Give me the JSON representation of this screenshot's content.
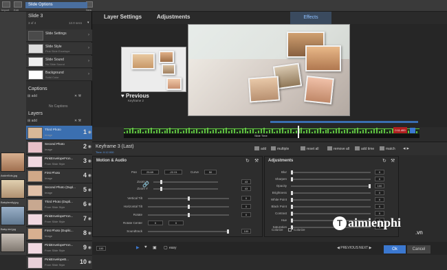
{
  "window": {
    "title": "Slide Options"
  },
  "toolbar": {
    "labels": [
      "Import",
      "Edit",
      "New"
    ]
  },
  "host_thumbs": [
    {
      "label": "AskinKids.jpg"
    },
    {
      "label": "Babyfamily.jpg"
    },
    {
      "label": "Baby-kid.jpg"
    }
  ],
  "slide": {
    "title": "Slide 3",
    "count": "3 of 4",
    "duration": "12.0 secs"
  },
  "settings": [
    {
      "label": "Slide Settings",
      "sub": ""
    },
    {
      "label": "Slide Style",
      "sub": "Pink Slide Envelope"
    },
    {
      "label": "Slide Sound",
      "sub": "No Slide Sound"
    },
    {
      "label": "Background",
      "sub": "Solid Color"
    }
  ],
  "captions": {
    "header": "Captions",
    "add": "add",
    "empty": "No Captions"
  },
  "layers": {
    "header": "Layers",
    "add": "add",
    "items": [
      {
        "name": "Third Photo",
        "sub": "Image",
        "num": "1",
        "selected": true
      },
      {
        "name": "Second Photo",
        "sub": "Image",
        "num": "2",
        "selected": false
      },
      {
        "name": "PinkEnvelopeFron...",
        "sub": "From Slide Style",
        "num": "3",
        "selected": false
      },
      {
        "name": "First Photo",
        "sub": "Image",
        "num": "4",
        "selected": false
      },
      {
        "name": "Second Photo (Dupl...",
        "sub": "Image",
        "num": "5",
        "selected": false
      },
      {
        "name": "Third Photo (Dupli...",
        "sub": "From Slide Style",
        "num": "6",
        "selected": false
      },
      {
        "name": "PinkEnvelopeFron...",
        "sub": "From Slide Style",
        "num": "7",
        "selected": false
      },
      {
        "name": "First Photo (Duplic...",
        "sub": "Image",
        "num": "8",
        "selected": false
      },
      {
        "name": "PinkEnvelopeFron...",
        "sub": "From Slide Style",
        "num": "9",
        "selected": false
      },
      {
        "name": "PinkEnvelopeB...",
        "sub": "From Slide Style",
        "num": "10",
        "selected": false
      }
    ]
  },
  "tabs": {
    "layer_settings": "Layer Settings",
    "adjustments": "Adjustments",
    "effects": "Effects"
  },
  "preview": {
    "previous_label": "Previous",
    "previous_sub": "Keyframe 2"
  },
  "timeline": {
    "slide_time": "Slide Time",
    "end_time": "0:11.400"
  },
  "keyframe": {
    "title": "Keyframe 3 (Last)",
    "sub": "Time: 0:12.000",
    "actions": {
      "add": "add",
      "multiple": "multiple",
      "reset_all": "reset all",
      "remove_all": "remove all",
      "add_time": "add time",
      "match": "match"
    }
  },
  "motion": {
    "title": "Motion & Audio",
    "pan_label": "Pan",
    "pan_x": "25.69",
    "pan_y": "-22.01",
    "curve_label": "Curve",
    "curve_val": "50",
    "zoom_x_label": "Zoom X",
    "zoom_x_val": "43",
    "zoom_y_label": "Zoom Y",
    "zoom_y_val": "43",
    "vtilt_label": "Vertical Tilt",
    "vtilt_val": "0",
    "htilt_label": "Horizontal Tilt",
    "htilt_val": "0",
    "rotate_label": "Rotate",
    "rotate_val": "0",
    "rotcenter_label": "Rotate Center",
    "rotcenter_x": "0",
    "rotcenter_y": "0",
    "soundtrack_label": "Soundtrack",
    "soundtrack_val": "100"
  },
  "adjustments": {
    "title": "Adjustments",
    "rows": [
      {
        "label": "Blur",
        "val": "0"
      },
      {
        "label": "Sharpen",
        "val": "0"
      },
      {
        "label": "Opacity",
        "val": "100"
      },
      {
        "label": "Brightness",
        "val": "0"
      },
      {
        "label": "White Point",
        "val": "0"
      },
      {
        "label": "Black Point",
        "val": "0"
      },
      {
        "label": "Contrast",
        "val": "0"
      },
      {
        "label": "Hue",
        "val": "0"
      },
      {
        "label": "Saturation",
        "val": "0"
      }
    ],
    "colorize_label": "Colorize",
    "colorize2_label": "Colorize"
  },
  "bottom": {
    "zoom": "100",
    "easy": "easy",
    "previous": "PREVIOUS",
    "next": "NEXT",
    "ok": "Ok",
    "cancel": "Cancel"
  },
  "watermark": {
    "letter": "T",
    "text": "aimienphi",
    "domain": ".vn"
  },
  "colors": {
    "accent": "#3b78d0",
    "selected_layer": "#3b6fb0",
    "tab_active": "#8fc1ff"
  }
}
